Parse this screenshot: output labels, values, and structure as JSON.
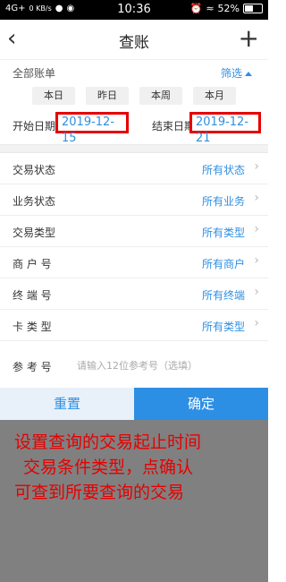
{
  "status_bar": {
    "network": "4G+",
    "speed": "0 KB/s",
    "time": "10:36",
    "battery": "52%",
    "battery_level": 0.52
  },
  "header": {
    "back_icon": "chevron-left-icon",
    "title": "查账",
    "add_icon": "plus-icon"
  },
  "filter_bar": {
    "all_bills": "全部账单",
    "filter": "筛选"
  },
  "quick_dates": [
    "本日",
    "昨日",
    "本周",
    "本月"
  ],
  "date_range": {
    "start_label": "开始日期",
    "start_value": "2019-12-15",
    "end_label": "结束日期",
    "end_value": "2019-12-21",
    "highlight_color": "#e60000"
  },
  "conditions": [
    {
      "label": "交易状态",
      "value": "所有状态"
    },
    {
      "label": "业务状态",
      "value": "所有业务"
    },
    {
      "label": "交易类型",
      "value": "所有类型"
    },
    {
      "label": "商 户 号",
      "value": "所有商户"
    },
    {
      "label": "终 端 号",
      "value": "所有终端"
    },
    {
      "label": "卡 类 型",
      "value": "所有类型"
    }
  ],
  "reference": {
    "label": "参 考 号",
    "placeholder": "请输入12位参考号（选填）"
  },
  "actions": {
    "reset": "重置",
    "confirm": "确定"
  },
  "annotation": {
    "line1": "设置查询的交易起止时间",
    "line2": "交易条件类型，点确认",
    "line3": "可查到所要查询的交易"
  },
  "colors": {
    "accent": "#2d8fe3",
    "annotation_text": "#e60000",
    "overlay": "#808080"
  }
}
